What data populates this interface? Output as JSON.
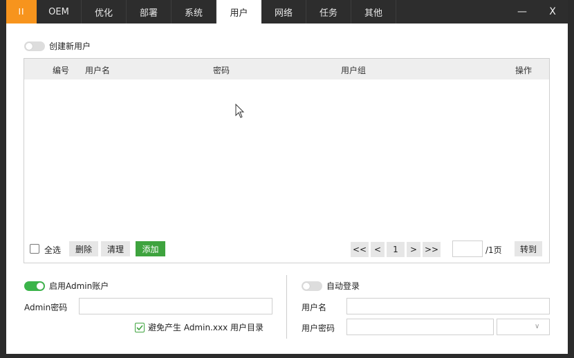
{
  "titlebar": {
    "pause_label": "II",
    "tabs": [
      "OEM",
      "优化",
      "部署",
      "系统",
      "用户",
      "网络",
      "任务",
      "其他"
    ],
    "active_tab": "用户",
    "minimize_label": "—",
    "close_label": "X"
  },
  "create_user": {
    "toggle_on": false,
    "label": "创建新用户"
  },
  "table": {
    "columns": [
      "编号",
      "用户名",
      "密码",
      "用户组",
      "操作"
    ],
    "rows": []
  },
  "table_footer": {
    "select_all_label": "全选",
    "delete_label": "删除",
    "clear_label": "清理",
    "add_label": "添加",
    "first_label": "<<",
    "prev_label": "<",
    "current_page": "1",
    "next_label": ">",
    "last_label": ">>",
    "page_input_value": "",
    "total_pages_label": "/1页",
    "goto_label": "转到"
  },
  "admin": {
    "toggle_on": true,
    "enable_label": "启用Admin账户",
    "password_label": "Admin密码",
    "password_value": "",
    "avoid_checked": true,
    "avoid_label": "避免产生 Admin.xxx 用户目录"
  },
  "autologin": {
    "toggle_on": false,
    "label": "自动登录",
    "username_label": "用户名",
    "username_value": "",
    "password_label": "用户密码",
    "password_value": "",
    "dropdown_value": ""
  },
  "colors": {
    "accent_orange": "#f7941d",
    "titlebar_bg": "#2d2d2d",
    "toggle_on": "#3bb44a",
    "add_button": "#3ea33e"
  }
}
